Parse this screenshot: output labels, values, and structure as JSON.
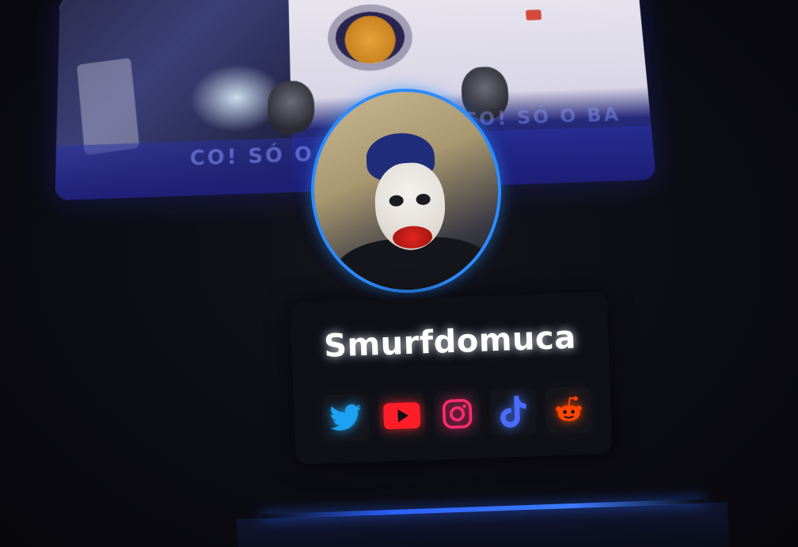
{
  "banner": {
    "scroll_text": "CO! SÓ O BA",
    "scroll_text_2": "CO! SÓ O BA"
  },
  "profile": {
    "username": "Smurfdomuca"
  },
  "socials": [
    {
      "name": "Twitter",
      "icon": "twitter-icon",
      "color": "#1DA1F2"
    },
    {
      "name": "YouTube",
      "icon": "youtube-icon",
      "color": "#FF1E28"
    },
    {
      "name": "Instagram",
      "icon": "instagram-icon",
      "color": "#FF2D6F"
    },
    {
      "name": "TikTok",
      "icon": "tiktok-icon",
      "color": "#4A6CFF"
    },
    {
      "name": "Reddit",
      "icon": "reddit-icon",
      "color": "#FF4500"
    }
  ],
  "colors": {
    "accent": "#2C8CFF",
    "background": "#0B0B12"
  }
}
